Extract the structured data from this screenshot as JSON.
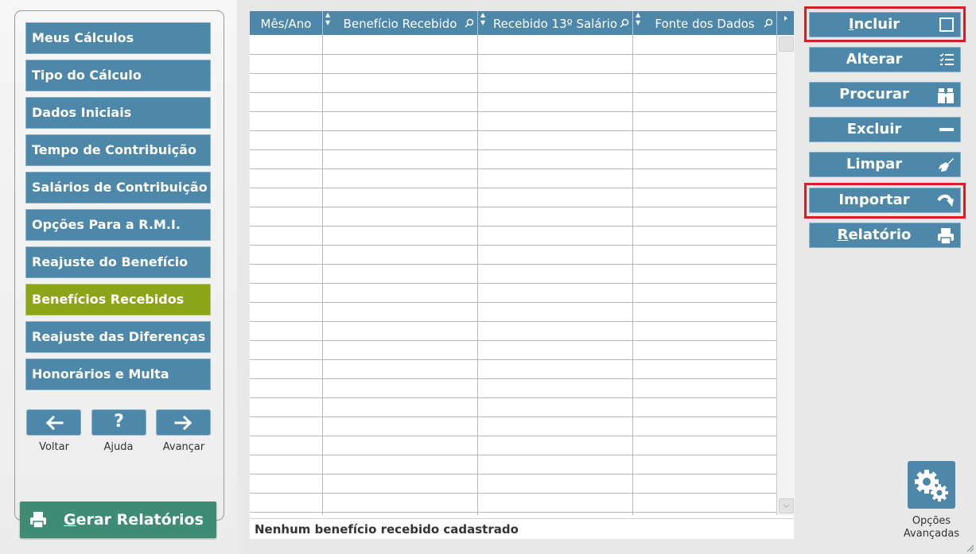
{
  "sidebar": {
    "items": [
      {
        "label": "Meus Cálculos",
        "active": false
      },
      {
        "label": "Tipo do Cálculo",
        "active": false
      },
      {
        "label": "Dados Iniciais",
        "active": false
      },
      {
        "label": "Tempo de Contribuição",
        "active": false
      },
      {
        "label": "Salários de Contribuição",
        "active": false
      },
      {
        "label": "Opções Para a R.M.I.",
        "active": false
      },
      {
        "label": "Reajuste do Benefício",
        "active": false
      },
      {
        "label": "Benefícios Recebidos",
        "active": true
      },
      {
        "label": "Reajuste das Diferenças",
        "active": false
      },
      {
        "label": "Honorários e Multa",
        "active": false
      }
    ],
    "nav": {
      "back_label": "Voltar",
      "help_label": "Ajuda",
      "next_label": "Avançar",
      "help_glyph": "?"
    },
    "report_button": {
      "prefix": "G",
      "rest": "erar Relatórios"
    }
  },
  "grid": {
    "columns": [
      "Mês/Ano",
      "Benefício Recebido",
      "Recebido 13º Salário",
      "Fonte dos Dados"
    ],
    "status_text": "Nenhum benefício recebido cadastrado"
  },
  "actions": {
    "incluir": {
      "prefix": "I",
      "rest": "ncluir",
      "icon": "square-icon"
    },
    "alterar": {
      "label": "Alterar",
      "icon": "list-icon"
    },
    "procurar": {
      "label": "Procurar",
      "icon": "binoculars-icon"
    },
    "excluir": {
      "label": "Excluir",
      "icon": "minus-icon"
    },
    "limpar": {
      "label": "Limpar",
      "icon": "brush-icon"
    },
    "importar": {
      "label": "Importar",
      "icon": "redo-arrow-icon"
    },
    "relatorio": {
      "prefix": "R",
      "rest": "elatório",
      "icon": "printer-icon"
    }
  },
  "advanced": {
    "line1": "Opções",
    "line2": "Avançadas"
  },
  "colors": {
    "primary": "#4d87aa",
    "active": "#8ca518",
    "report": "#3f8b74",
    "highlight": "#d42020"
  }
}
